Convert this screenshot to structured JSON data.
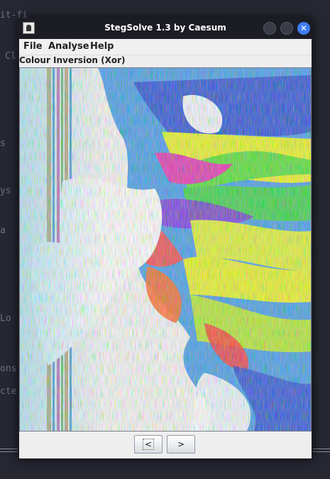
{
  "window": {
    "title": "StegSolve 1.3 by Caesum",
    "close_glyph": "✕"
  },
  "menu": {
    "items": [
      {
        "label": "File"
      },
      {
        "label": "Analyse"
      },
      {
        "label": "Help"
      }
    ]
  },
  "view": {
    "mode_label": "Colour Inversion (Xor)"
  },
  "nav": {
    "prev_label": "<",
    "next_label": ">"
  },
  "colors": {
    "desktop": "#262731",
    "window_frame": "#1b1c24",
    "close_button": "#3f7bf2",
    "client": "#eeeeee"
  },
  "background_fragments": [
    "it-fi",
    "Cl",
    "s",
    "ys",
    "Lo",
    "ons",
    "cte",
    "e",
    "a"
  ]
}
